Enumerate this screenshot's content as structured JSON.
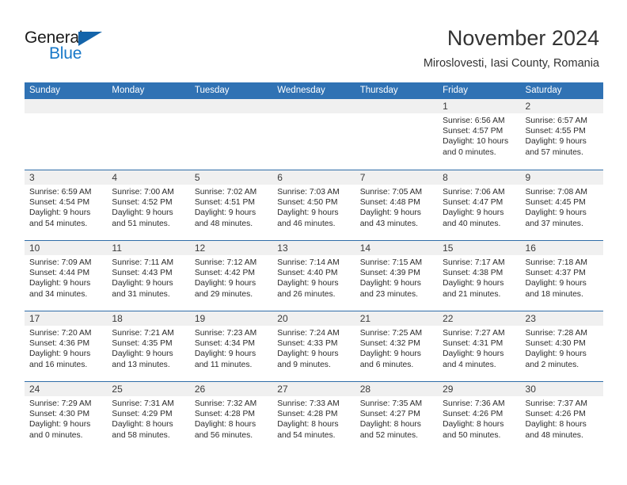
{
  "brand": {
    "name_top": "General",
    "name_bottom": "Blue",
    "triangle_icon": "triangle-icon",
    "color_blue": "#1878c8",
    "color_triangle": "#1464aa"
  },
  "header": {
    "title": "November 2024",
    "subtitle": "Miroslovesti, Iasi County, Romania"
  },
  "theme": {
    "header_bar": "#3072b4",
    "row_separator": "#2f6da8",
    "day_band": "#f0f0f0"
  },
  "weekdays": [
    "Sunday",
    "Monday",
    "Tuesday",
    "Wednesday",
    "Thursday",
    "Friday",
    "Saturday"
  ],
  "weeks": [
    [
      {
        "day": "",
        "l1": "",
        "l2": "",
        "l3": "",
        "l4": ""
      },
      {
        "day": "",
        "l1": "",
        "l2": "",
        "l3": "",
        "l4": ""
      },
      {
        "day": "",
        "l1": "",
        "l2": "",
        "l3": "",
        "l4": ""
      },
      {
        "day": "",
        "l1": "",
        "l2": "",
        "l3": "",
        "l4": ""
      },
      {
        "day": "",
        "l1": "",
        "l2": "",
        "l3": "",
        "l4": ""
      },
      {
        "day": "1",
        "l1": "Sunrise: 6:56 AM",
        "l2": "Sunset: 4:57 PM",
        "l3": "Daylight: 10 hours",
        "l4": "and 0 minutes."
      },
      {
        "day": "2",
        "l1": "Sunrise: 6:57 AM",
        "l2": "Sunset: 4:55 PM",
        "l3": "Daylight: 9 hours",
        "l4": "and 57 minutes."
      }
    ],
    [
      {
        "day": "3",
        "l1": "Sunrise: 6:59 AM",
        "l2": "Sunset: 4:54 PM",
        "l3": "Daylight: 9 hours",
        "l4": "and 54 minutes."
      },
      {
        "day": "4",
        "l1": "Sunrise: 7:00 AM",
        "l2": "Sunset: 4:52 PM",
        "l3": "Daylight: 9 hours",
        "l4": "and 51 minutes."
      },
      {
        "day": "5",
        "l1": "Sunrise: 7:02 AM",
        "l2": "Sunset: 4:51 PM",
        "l3": "Daylight: 9 hours",
        "l4": "and 48 minutes."
      },
      {
        "day": "6",
        "l1": "Sunrise: 7:03 AM",
        "l2": "Sunset: 4:50 PM",
        "l3": "Daylight: 9 hours",
        "l4": "and 46 minutes."
      },
      {
        "day": "7",
        "l1": "Sunrise: 7:05 AM",
        "l2": "Sunset: 4:48 PM",
        "l3": "Daylight: 9 hours",
        "l4": "and 43 minutes."
      },
      {
        "day": "8",
        "l1": "Sunrise: 7:06 AM",
        "l2": "Sunset: 4:47 PM",
        "l3": "Daylight: 9 hours",
        "l4": "and 40 minutes."
      },
      {
        "day": "9",
        "l1": "Sunrise: 7:08 AM",
        "l2": "Sunset: 4:45 PM",
        "l3": "Daylight: 9 hours",
        "l4": "and 37 minutes."
      }
    ],
    [
      {
        "day": "10",
        "l1": "Sunrise: 7:09 AM",
        "l2": "Sunset: 4:44 PM",
        "l3": "Daylight: 9 hours",
        "l4": "and 34 minutes."
      },
      {
        "day": "11",
        "l1": "Sunrise: 7:11 AM",
        "l2": "Sunset: 4:43 PM",
        "l3": "Daylight: 9 hours",
        "l4": "and 31 minutes."
      },
      {
        "day": "12",
        "l1": "Sunrise: 7:12 AM",
        "l2": "Sunset: 4:42 PM",
        "l3": "Daylight: 9 hours",
        "l4": "and 29 minutes."
      },
      {
        "day": "13",
        "l1": "Sunrise: 7:14 AM",
        "l2": "Sunset: 4:40 PM",
        "l3": "Daylight: 9 hours",
        "l4": "and 26 minutes."
      },
      {
        "day": "14",
        "l1": "Sunrise: 7:15 AM",
        "l2": "Sunset: 4:39 PM",
        "l3": "Daylight: 9 hours",
        "l4": "and 23 minutes."
      },
      {
        "day": "15",
        "l1": "Sunrise: 7:17 AM",
        "l2": "Sunset: 4:38 PM",
        "l3": "Daylight: 9 hours",
        "l4": "and 21 minutes."
      },
      {
        "day": "16",
        "l1": "Sunrise: 7:18 AM",
        "l2": "Sunset: 4:37 PM",
        "l3": "Daylight: 9 hours",
        "l4": "and 18 minutes."
      }
    ],
    [
      {
        "day": "17",
        "l1": "Sunrise: 7:20 AM",
        "l2": "Sunset: 4:36 PM",
        "l3": "Daylight: 9 hours",
        "l4": "and 16 minutes."
      },
      {
        "day": "18",
        "l1": "Sunrise: 7:21 AM",
        "l2": "Sunset: 4:35 PM",
        "l3": "Daylight: 9 hours",
        "l4": "and 13 minutes."
      },
      {
        "day": "19",
        "l1": "Sunrise: 7:23 AM",
        "l2": "Sunset: 4:34 PM",
        "l3": "Daylight: 9 hours",
        "l4": "and 11 minutes."
      },
      {
        "day": "20",
        "l1": "Sunrise: 7:24 AM",
        "l2": "Sunset: 4:33 PM",
        "l3": "Daylight: 9 hours",
        "l4": "and 9 minutes."
      },
      {
        "day": "21",
        "l1": "Sunrise: 7:25 AM",
        "l2": "Sunset: 4:32 PM",
        "l3": "Daylight: 9 hours",
        "l4": "and 6 minutes."
      },
      {
        "day": "22",
        "l1": "Sunrise: 7:27 AM",
        "l2": "Sunset: 4:31 PM",
        "l3": "Daylight: 9 hours",
        "l4": "and 4 minutes."
      },
      {
        "day": "23",
        "l1": "Sunrise: 7:28 AM",
        "l2": "Sunset: 4:30 PM",
        "l3": "Daylight: 9 hours",
        "l4": "and 2 minutes."
      }
    ],
    [
      {
        "day": "24",
        "l1": "Sunrise: 7:29 AM",
        "l2": "Sunset: 4:30 PM",
        "l3": "Daylight: 9 hours",
        "l4": "and 0 minutes."
      },
      {
        "day": "25",
        "l1": "Sunrise: 7:31 AM",
        "l2": "Sunset: 4:29 PM",
        "l3": "Daylight: 8 hours",
        "l4": "and 58 minutes."
      },
      {
        "day": "26",
        "l1": "Sunrise: 7:32 AM",
        "l2": "Sunset: 4:28 PM",
        "l3": "Daylight: 8 hours",
        "l4": "and 56 minutes."
      },
      {
        "day": "27",
        "l1": "Sunrise: 7:33 AM",
        "l2": "Sunset: 4:28 PM",
        "l3": "Daylight: 8 hours",
        "l4": "and 54 minutes."
      },
      {
        "day": "28",
        "l1": "Sunrise: 7:35 AM",
        "l2": "Sunset: 4:27 PM",
        "l3": "Daylight: 8 hours",
        "l4": "and 52 minutes."
      },
      {
        "day": "29",
        "l1": "Sunrise: 7:36 AM",
        "l2": "Sunset: 4:26 PM",
        "l3": "Daylight: 8 hours",
        "l4": "and 50 minutes."
      },
      {
        "day": "30",
        "l1": "Sunrise: 7:37 AM",
        "l2": "Sunset: 4:26 PM",
        "l3": "Daylight: 8 hours",
        "l4": "and 48 minutes."
      }
    ]
  ]
}
